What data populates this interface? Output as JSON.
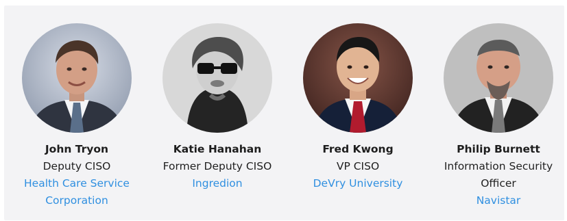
{
  "people": [
    {
      "name": "John Tryon",
      "title": "Deputy CISO",
      "company": "Health Care Service Corporation",
      "avatar_icon": "person-photo-icon"
    },
    {
      "name": "Katie Hanahan",
      "title": "Former Deputy CISO",
      "company": "Ingredion",
      "avatar_icon": "person-photo-icon"
    },
    {
      "name": "Fred Kwong",
      "title": "VP CISO",
      "company": "DeVry University",
      "avatar_icon": "person-photo-icon"
    },
    {
      "name": "Philip Burnett",
      "title": "Information Security Officer",
      "company": "Navistar",
      "avatar_icon": "person-photo-icon"
    }
  ],
  "colors": {
    "panel_background": "#f3f3f5",
    "link": "#2f8fe0",
    "text": "#1f1f1f"
  }
}
